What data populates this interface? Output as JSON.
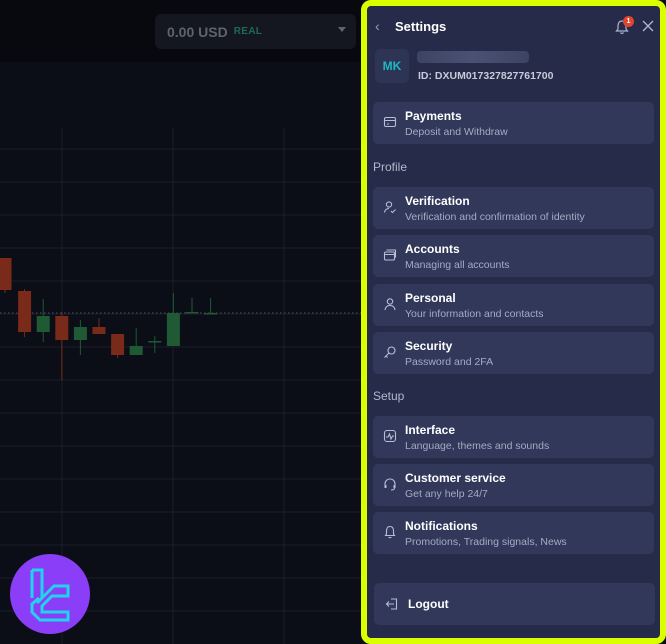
{
  "topbar": {
    "balance": {
      "amount": "0.00 USD",
      "account_type": "REAL"
    }
  },
  "chart_data": {
    "type": "candlestick",
    "price_line": "dotted",
    "candles": [
      {
        "dir": "down",
        "open": 0.92,
        "close": 0.6,
        "high": 0.92,
        "low": 0.57
      },
      {
        "dir": "down",
        "open": 0.59,
        "close": 0.18,
        "high": 0.61,
        "low": 0.13
      },
      {
        "dir": "up",
        "open": 0.18,
        "close": 0.34,
        "high": 0.51,
        "low": 0.08
      },
      {
        "dir": "down",
        "open": 0.34,
        "close": 0.1,
        "high": 0.38,
        "low": -0.3
      },
      {
        "dir": "up",
        "open": 0.1,
        "close": 0.23,
        "high": 0.3,
        "low": -0.05
      },
      {
        "dir": "down",
        "open": 0.23,
        "close": 0.16,
        "high": 0.32,
        "low": 0.16
      },
      {
        "dir": "down",
        "open": 0.16,
        "close": -0.05,
        "high": 0.16,
        "low": -0.08
      },
      {
        "dir": "up",
        "open": -0.05,
        "close": 0.04,
        "high": 0.22,
        "low": -0.05
      },
      {
        "dir": "up",
        "open": 0.08,
        "close": 0.09,
        "high": 0.14,
        "low": -0.03
      },
      {
        "dir": "up",
        "open": 0.04,
        "close": 0.37,
        "high": 0.57,
        "low": 0.04
      },
      {
        "dir": "up",
        "open": 0.37,
        "close": 0.38,
        "high": 0.52,
        "low": 0.37
      },
      {
        "dir": "up",
        "open": 0.37,
        "close": 0.37,
        "high": 0.52,
        "low": 0.37
      }
    ]
  },
  "panel": {
    "title": "Settings",
    "notification_count": "1",
    "user": {
      "initials": "MK",
      "id": "ID: DXUM017327827761700"
    },
    "payments": {
      "title": "Payments",
      "subtitle": "Deposit and Withdraw"
    },
    "sections": [
      {
        "label": "Profile",
        "items": [
          {
            "title": "Verification",
            "subtitle": "Verification and confirmation of identity",
            "icon": "user-check-icon"
          },
          {
            "title": "Accounts",
            "subtitle": "Managing all accounts",
            "icon": "cards-icon"
          },
          {
            "title": "Personal",
            "subtitle": "Your information and contacts",
            "icon": "user-icon"
          },
          {
            "title": "Security",
            "subtitle": "Password and 2FA",
            "icon": "key-icon"
          }
        ]
      },
      {
        "label": "Setup",
        "items": [
          {
            "title": "Interface",
            "subtitle": "Language, themes and sounds",
            "icon": "interface-icon"
          },
          {
            "title": "Customer service",
            "subtitle": "Get any help 24/7",
            "icon": "headset-icon"
          },
          {
            "title": "Notifications",
            "subtitle": "Promotions, Trading signals, News",
            "icon": "bell-icon"
          }
        ]
      }
    ],
    "logout": "Logout"
  },
  "colors": {
    "accent_border": "#dcff00",
    "panel_bg": "#252b48",
    "up": "#1f5a35",
    "down": "#7a2a18",
    "logo_bg": "#8a3ef7",
    "logo_fg": "#22d3ee"
  }
}
